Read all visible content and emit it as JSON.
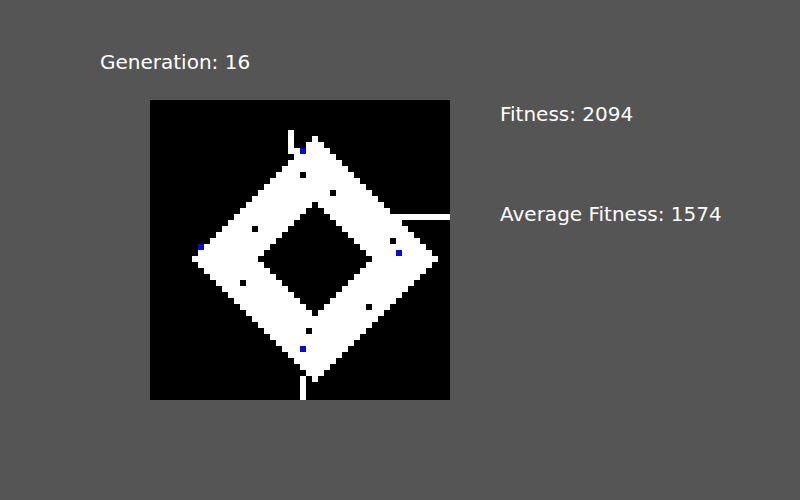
{
  "header": {
    "generation": "Generation: 16"
  },
  "stats": [
    {
      "label": "Fitness: 2094"
    },
    {
      "label": "Average Fitness: 1574"
    }
  ],
  "world": {
    "columns": 50,
    "rows": 50,
    "live_runs": [
      [],
      [],
      [],
      [],
      [],
      [
        [
          23,
          23
        ]
      ],
      [
        [
          23,
          23
        ],
        [
          27,
          27
        ]
      ],
      [
        [
          23,
          23
        ],
        [
          26,
          28
        ]
      ],
      [
        [
          23,
          29
        ]
      ],
      [
        [
          24,
          30
        ]
      ],
      [
        [
          23,
          31
        ]
      ],
      [
        [
          22,
          32
        ]
      ],
      [
        [
          21,
          24
        ],
        [
          26,
          33
        ]
      ],
      [
        [
          20,
          34
        ]
      ],
      [
        [
          19,
          35
        ]
      ],
      [
        [
          18,
          29
        ],
        [
          31,
          36
        ]
      ],
      [
        [
          17,
          37
        ]
      ],
      [
        [
          16,
          26
        ],
        [
          28,
          38
        ]
      ],
      [
        [
          15,
          25
        ],
        [
          29,
          39
        ]
      ],
      [
        [
          14,
          24
        ],
        [
          30,
          49
        ]
      ],
      [
        [
          13,
          23
        ],
        [
          31,
          41
        ]
      ],
      [
        [
          12,
          16
        ],
        [
          18,
          22
        ],
        [
          32,
          42
        ]
      ],
      [
        [
          11,
          21
        ],
        [
          33,
          43
        ]
      ],
      [
        [
          10,
          20
        ],
        [
          34,
          39
        ],
        [
          41,
          44
        ]
      ],
      [
        [
          8,
          19
        ],
        [
          35,
          45
        ]
      ],
      [
        [
          8,
          18
        ],
        [
          36,
          46
        ]
      ],
      [
        [
          7,
          17
        ],
        [
          37,
          47
        ]
      ],
      [
        [
          8,
          18
        ],
        [
          36,
          46
        ]
      ],
      [
        [
          9,
          19
        ],
        [
          35,
          45
        ]
      ],
      [
        [
          10,
          20
        ],
        [
          34,
          44
        ]
      ],
      [
        [
          11,
          14
        ],
        [
          16,
          21
        ],
        [
          33,
          43
        ]
      ],
      [
        [
          12,
          22
        ],
        [
          32,
          42
        ]
      ],
      [
        [
          13,
          23
        ],
        [
          31,
          41
        ]
      ],
      [
        [
          14,
          24
        ],
        [
          30,
          40
        ]
      ],
      [
        [
          15,
          25
        ],
        [
          29,
          35
        ],
        [
          37,
          39
        ]
      ],
      [
        [
          16,
          26
        ],
        [
          28,
          38
        ]
      ],
      [
        [
          17,
          37
        ]
      ],
      [
        [
          18,
          36
        ]
      ],
      [
        [
          19,
          25
        ],
        [
          27,
          35
        ]
      ],
      [
        [
          20,
          34
        ]
      ],
      [
        [
          21,
          33
        ]
      ],
      [
        [
          22,
          32
        ]
      ],
      [
        [
          23,
          31
        ]
      ],
      [
        [
          24,
          30
        ]
      ],
      [
        [
          25,
          29
        ]
      ],
      [
        [
          26,
          28
        ]
      ],
      [
        [
          25,
          25
        ],
        [
          27,
          27
        ]
      ],
      [
        [
          25,
          25
        ]
      ],
      [
        [
          25,
          25
        ]
      ],
      [
        [
          25,
          25
        ]
      ]
    ],
    "agents": [
      {
        "col": 25,
        "row": 8
      },
      {
        "col": 41,
        "row": 25
      },
      {
        "col": 8,
        "row": 24
      },
      {
        "col": 25,
        "row": 41
      }
    ]
  }
}
